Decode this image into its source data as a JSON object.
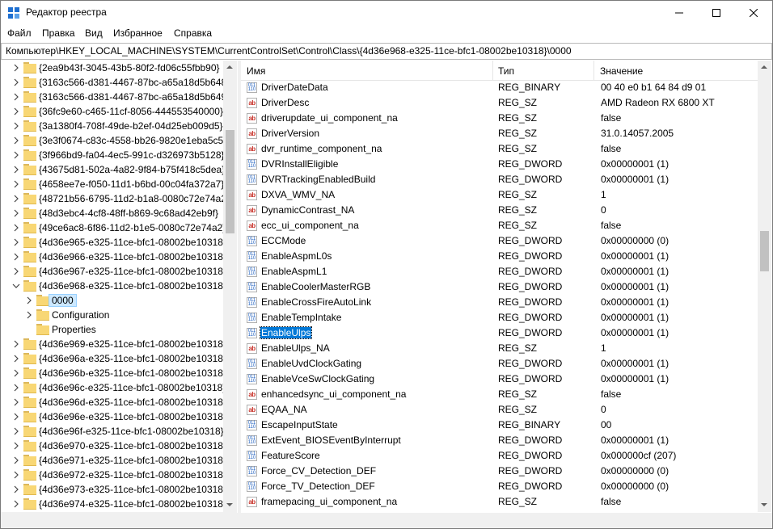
{
  "window": {
    "title": "Редактор реестра",
    "accent": "#0078d7"
  },
  "menu": [
    "Файл",
    "Правка",
    "Вид",
    "Избранное",
    "Справка"
  ],
  "address": "Компьютер\\HKEY_LOCAL_MACHINE\\SYSTEM\\CurrentControlSet\\Control\\Class\\{4d36e968-e325-11ce-bfc1-08002be10318}\\0000",
  "tree": [
    {
      "label": "{2ea9b43f-3045-43b5-80f2-fd06c55fbb90}",
      "depth": 0,
      "expander": "collapsed"
    },
    {
      "label": "{3163c566-d381-4467-87bc-a65a18d5b648}",
      "depth": 0,
      "expander": "collapsed"
    },
    {
      "label": "{3163c566-d381-4467-87bc-a65a18d5b649}",
      "depth": 0,
      "expander": "collapsed"
    },
    {
      "label": "{36fc9e60-c465-11cf-8056-444553540000}",
      "depth": 0,
      "expander": "collapsed"
    },
    {
      "label": "{3a1380f4-708f-49de-b2ef-04d25eb009d5}",
      "depth": 0,
      "expander": "collapsed"
    },
    {
      "label": "{3e3f0674-c83c-4558-bb26-9820e1eba5c5}",
      "depth": 0,
      "expander": "collapsed"
    },
    {
      "label": "{3f966bd9-fa04-4ec5-991c-d326973b5128}",
      "depth": 0,
      "expander": "collapsed"
    },
    {
      "label": "{43675d81-502a-4a82-9f84-b75f418c5dea}",
      "depth": 0,
      "expander": "collapsed"
    },
    {
      "label": "{4658ee7e-f050-11d1-b6bd-00c04fa372a7}",
      "depth": 0,
      "expander": "collapsed"
    },
    {
      "label": "{48721b56-6795-11d2-b1a8-0080c72e74a2}",
      "depth": 0,
      "expander": "collapsed"
    },
    {
      "label": "{48d3ebc4-4cf8-48ff-b869-9c68ad42eb9f}",
      "depth": 0,
      "expander": "collapsed"
    },
    {
      "label": "{49ce6ac8-6f86-11d2-b1e5-0080c72e74a2}",
      "depth": 0,
      "expander": "collapsed"
    },
    {
      "label": "{4d36e965-e325-11ce-bfc1-08002be10318}",
      "depth": 0,
      "expander": "collapsed"
    },
    {
      "label": "{4d36e966-e325-11ce-bfc1-08002be10318}",
      "depth": 0,
      "expander": "collapsed"
    },
    {
      "label": "{4d36e967-e325-11ce-bfc1-08002be10318}",
      "depth": 0,
      "expander": "collapsed"
    },
    {
      "label": "{4d36e968-e325-11ce-bfc1-08002be10318}",
      "depth": 0,
      "expander": "expanded"
    },
    {
      "label": "0000",
      "depth": 1,
      "expander": "collapsed",
      "selected": true
    },
    {
      "label": "Configuration",
      "depth": 1,
      "expander": "collapsed"
    },
    {
      "label": "Properties",
      "depth": 1,
      "expander": "none"
    },
    {
      "label": "{4d36e969-e325-11ce-bfc1-08002be10318}",
      "depth": 0,
      "expander": "collapsed"
    },
    {
      "label": "{4d36e96a-e325-11ce-bfc1-08002be10318}",
      "depth": 0,
      "expander": "collapsed"
    },
    {
      "label": "{4d36e96b-e325-11ce-bfc1-08002be10318}",
      "depth": 0,
      "expander": "collapsed"
    },
    {
      "label": "{4d36e96c-e325-11ce-bfc1-08002be10318}",
      "depth": 0,
      "expander": "collapsed"
    },
    {
      "label": "{4d36e96d-e325-11ce-bfc1-08002be10318}",
      "depth": 0,
      "expander": "collapsed"
    },
    {
      "label": "{4d36e96e-e325-11ce-bfc1-08002be10318}",
      "depth": 0,
      "expander": "collapsed"
    },
    {
      "label": "{4d36e96f-e325-11ce-bfc1-08002be10318}",
      "depth": 0,
      "expander": "collapsed"
    },
    {
      "label": "{4d36e970-e325-11ce-bfc1-08002be10318}",
      "depth": 0,
      "expander": "collapsed"
    },
    {
      "label": "{4d36e971-e325-11ce-bfc1-08002be10318}",
      "depth": 0,
      "expander": "collapsed"
    },
    {
      "label": "{4d36e972-e325-11ce-bfc1-08002be10318}",
      "depth": 0,
      "expander": "collapsed"
    },
    {
      "label": "{4d36e973-e325-11ce-bfc1-08002be10318}",
      "depth": 0,
      "expander": "collapsed"
    },
    {
      "label": "{4d36e974-e325-11ce-bfc1-08002be10318}",
      "depth": 0,
      "expander": "collapsed"
    }
  ],
  "columns": {
    "name": "Имя",
    "type": "Тип",
    "data": "Значение"
  },
  "values": [
    {
      "icon": "binary-value-icon",
      "name": "DriverDateData",
      "type": "REG_BINARY",
      "data": "00 40 e0 b1 64 84 d9 01"
    },
    {
      "icon": "string-value-icon",
      "name": "DriverDesc",
      "type": "REG_SZ",
      "data": "AMD Radeon RX 6800 XT"
    },
    {
      "icon": "string-value-icon",
      "name": "driverupdate_ui_component_na",
      "type": "REG_SZ",
      "data": "false"
    },
    {
      "icon": "string-value-icon",
      "name": "DriverVersion",
      "type": "REG_SZ",
      "data": "31.0.14057.2005"
    },
    {
      "icon": "string-value-icon",
      "name": "dvr_runtime_component_na",
      "type": "REG_SZ",
      "data": "false"
    },
    {
      "icon": "binary-value-icon",
      "name": "DVRInstallEligible",
      "type": "REG_DWORD",
      "data": "0x00000001 (1)"
    },
    {
      "icon": "binary-value-icon",
      "name": "DVRTrackingEnabledBuild",
      "type": "REG_DWORD",
      "data": "0x00000001 (1)"
    },
    {
      "icon": "string-value-icon",
      "name": "DXVA_WMV_NA",
      "type": "REG_SZ",
      "data": "1"
    },
    {
      "icon": "string-value-icon",
      "name": "DynamicContrast_NA",
      "type": "REG_SZ",
      "data": "0"
    },
    {
      "icon": "string-value-icon",
      "name": "ecc_ui_component_na",
      "type": "REG_SZ",
      "data": "false"
    },
    {
      "icon": "binary-value-icon",
      "name": "ECCMode",
      "type": "REG_DWORD",
      "data": "0x00000000 (0)"
    },
    {
      "icon": "binary-value-icon",
      "name": "EnableAspmL0s",
      "type": "REG_DWORD",
      "data": "0x00000001 (1)"
    },
    {
      "icon": "binary-value-icon",
      "name": "EnableAspmL1",
      "type": "REG_DWORD",
      "data": "0x00000001 (1)"
    },
    {
      "icon": "binary-value-icon",
      "name": "EnableCoolerMasterRGB",
      "type": "REG_DWORD",
      "data": "0x00000001 (1)"
    },
    {
      "icon": "binary-value-icon",
      "name": "EnableCrossFireAutoLink",
      "type": "REG_DWORD",
      "data": "0x00000001 (1)"
    },
    {
      "icon": "binary-value-icon",
      "name": "EnableTempIntake",
      "type": "REG_DWORD",
      "data": "0x00000001 (1)"
    },
    {
      "icon": "binary-value-icon",
      "name": "EnableUlps",
      "type": "REG_DWORD",
      "data": "0x00000001 (1)",
      "selected": true
    },
    {
      "icon": "string-value-icon",
      "name": "EnableUlps_NA",
      "type": "REG_SZ",
      "data": "1"
    },
    {
      "icon": "binary-value-icon",
      "name": "EnableUvdClockGating",
      "type": "REG_DWORD",
      "data": "0x00000001 (1)"
    },
    {
      "icon": "binary-value-icon",
      "name": "EnableVceSwClockGating",
      "type": "REG_DWORD",
      "data": "0x00000001 (1)"
    },
    {
      "icon": "string-value-icon",
      "name": "enhancedsync_ui_component_na",
      "type": "REG_SZ",
      "data": "false"
    },
    {
      "icon": "string-value-icon",
      "name": "EQAA_NA",
      "type": "REG_SZ",
      "data": "0"
    },
    {
      "icon": "binary-value-icon",
      "name": "EscapeInputState",
      "type": "REG_BINARY",
      "data": "00"
    },
    {
      "icon": "binary-value-icon",
      "name": "ExtEvent_BIOSEventByInterrupt",
      "type": "REG_DWORD",
      "data": "0x00000001 (1)"
    },
    {
      "icon": "binary-value-icon",
      "name": "FeatureScore",
      "type": "REG_DWORD",
      "data": "0x000000cf (207)"
    },
    {
      "icon": "binary-value-icon",
      "name": "Force_CV_Detection_DEF",
      "type": "REG_DWORD",
      "data": "0x00000000 (0)"
    },
    {
      "icon": "binary-value-icon",
      "name": "Force_TV_Detection_DEF",
      "type": "REG_DWORD",
      "data": "0x00000000 (0)"
    },
    {
      "icon": "string-value-icon",
      "name": "framepacing_ui_component_na",
      "type": "REG_SZ",
      "data": "false"
    }
  ]
}
